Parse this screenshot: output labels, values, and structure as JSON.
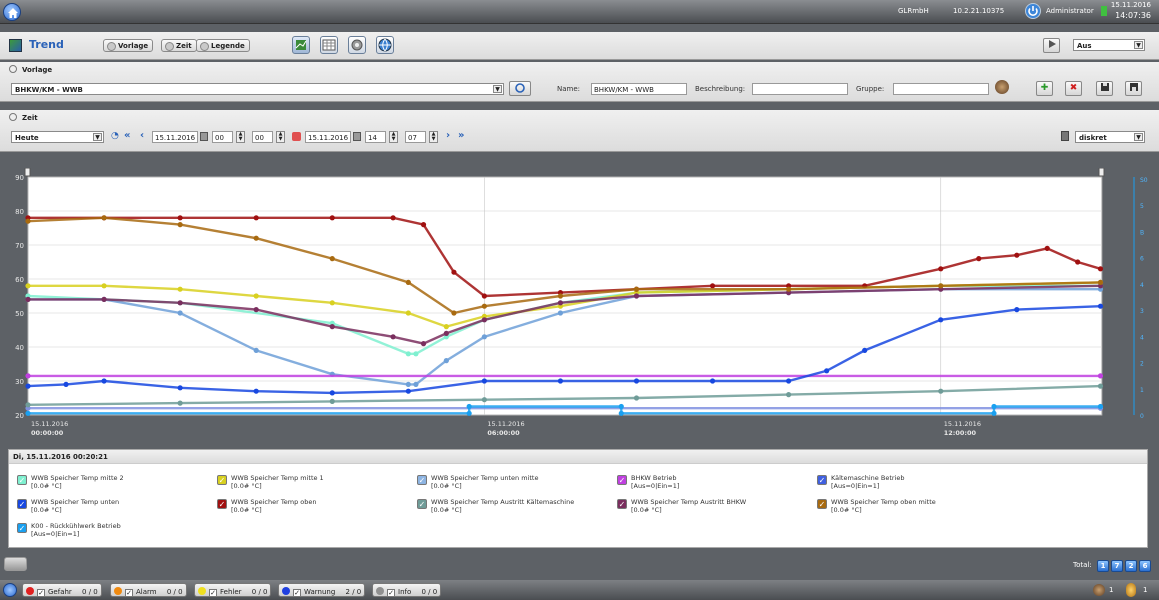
{
  "topbar": {
    "company": "GLRmbH",
    "ip": "10.2.21.10375",
    "user": "Administrator",
    "date": "15.11.2016",
    "time": "14:07:36"
  },
  "header": {
    "title": "Trend",
    "buttons": [
      "Vorlage",
      "Zeit",
      "Legende"
    ],
    "play_select": "Aus"
  },
  "vorlage": {
    "section_label": "Vorlage",
    "selected": "BHKW/KM - WWB",
    "name_label": "Name:",
    "name_value": "BHKW/KM - WWB",
    "desc_label": "Beschreibung:",
    "desc_value": "",
    "group_label": "Gruppe:",
    "group_value": ""
  },
  "zeit": {
    "section_label": "Zeit",
    "range": "Heute",
    "from_date": "15.11.2016",
    "from_h": "00",
    "from_m": "00",
    "to_date": "15.11.2016",
    "to_h": "14",
    "to_m": "07",
    "mode": "diskret"
  },
  "chart_data": {
    "type": "line",
    "ylim": [
      20,
      90
    ],
    "yticks": [
      "90",
      "80",
      "70",
      "60",
      "50",
      "40",
      "30",
      "20"
    ],
    "right_ticks": [
      "S0",
      "5",
      "B",
      "6",
      "4",
      "3",
      "4",
      "2",
      "1",
      "0"
    ],
    "x_range": [
      "00:00",
      "14:07"
    ],
    "xticks": [
      {
        "date": "15.11.2016",
        "time": "00:00:00",
        "h": 0
      },
      {
        "date": "15.11.2016",
        "time": "06:00:00",
        "h": 6
      },
      {
        "date": "15.11.2016",
        "time": "12:00:00",
        "h": 12
      }
    ],
    "series": [
      {
        "name": "WWB Speicher Temp mitte 2",
        "color": "#7ff0d0",
        "x": [
          0,
          2,
          4,
          5,
          5.1,
          5.5,
          6,
          7,
          8,
          10,
          12,
          14.1
        ],
        "values": [
          55,
          53,
          47,
          38,
          38,
          43,
          48,
          53,
          56,
          57,
          58,
          58
        ]
      },
      {
        "name": "WWB Speicher Temp mitte 1",
        "color": "#d8d020",
        "x": [
          0,
          1,
          2,
          3,
          4,
          5,
          5.5,
          6,
          7,
          8,
          10,
          12,
          14.1
        ],
        "values": [
          58,
          58,
          57,
          55,
          53,
          50,
          46,
          49,
          52,
          56,
          57,
          58,
          59
        ]
      },
      {
        "name": "WWB Speicher Temp unten mitte",
        "color": "#6ea0d8",
        "x": [
          0,
          1,
          2,
          3,
          4,
          5,
          5.1,
          5.5,
          6,
          7,
          8,
          10,
          12,
          14.1
        ],
        "values": [
          54,
          54,
          50,
          39,
          32,
          29,
          29,
          36,
          43,
          50,
          55,
          56,
          57,
          57
        ]
      },
      {
        "name": "BHKW Betrieb",
        "color": "#c040e0",
        "x": [
          0,
          14.1
        ],
        "values": [
          31.5,
          31.5
        ]
      },
      {
        "name": "Kältemaschine Betrieb",
        "color": "#8090e0",
        "x": [
          0,
          14.1
        ],
        "values": [
          22,
          22
        ]
      },
      {
        "name": "WWB Speicher Temp unten",
        "color": "#1848e0",
        "x": [
          0,
          0.5,
          1,
          2,
          3,
          4,
          5,
          6,
          7,
          8,
          9,
          10,
          10.5,
          11,
          12,
          13,
          14.1
        ],
        "values": [
          28.5,
          29,
          30,
          28,
          27,
          26.5,
          27,
          30,
          30,
          30,
          30,
          30,
          33,
          39,
          48,
          51,
          52
        ]
      },
      {
        "name": "WWB Speicher Temp oben",
        "color": "#a01010",
        "x": [
          0,
          1,
          2,
          3,
          4,
          4.8,
          5.2,
          5.6,
          6,
          7,
          8,
          9,
          10,
          11,
          12,
          12.5,
          13,
          13.4,
          13.8,
          14.1
        ],
        "values": [
          78,
          78,
          78,
          78,
          78,
          78,
          76,
          62,
          55,
          56,
          57,
          58,
          58,
          58,
          63,
          66,
          67,
          69,
          65,
          63
        ]
      },
      {
        "name": "WWB Speicher Temp Austritt Kältemaschine",
        "color": "#6f9c98",
        "x": [
          0,
          2,
          4,
          6,
          8,
          10,
          12,
          14.1
        ],
        "values": [
          23,
          23.5,
          24,
          24.5,
          25,
          26,
          27,
          28.5
        ]
      },
      {
        "name": "WWB Speicher Temp Austritt BHKW",
        "color": "#7a2e5e",
        "x": [
          0,
          1,
          2,
          3,
          4,
          4.8,
          5.2,
          5.5,
          6,
          7,
          8,
          10,
          12,
          14.1
        ],
        "values": [
          54,
          54,
          53,
          51,
          46,
          43,
          41,
          44,
          48,
          53,
          55,
          56,
          57,
          58
        ]
      },
      {
        "name": "WWB Speicher Temp oben mitte",
        "color": "#a86a10",
        "x": [
          0,
          1,
          2,
          3,
          4,
          5,
          5.6,
          6,
          7,
          8,
          10,
          12,
          14.1
        ],
        "values": [
          77,
          78,
          76,
          72,
          66,
          59,
          50,
          52,
          55,
          57,
          57,
          58,
          59
        ]
      },
      {
        "name": "K00 - Rückkühlwerk Betrieb",
        "color": "#1aa0f0",
        "x": [
          0,
          5.8,
          5.8,
          7.8,
          7.8,
          12.7,
          12.7,
          14.1
        ],
        "values": [
          20.5,
          20.5,
          22.5,
          22.5,
          20.5,
          20.5,
          22.5,
          22.5
        ]
      }
    ]
  },
  "legend": {
    "header": "Di, 15.11.2016 00:20:21",
    "items": [
      {
        "name": "WWB Speicher Temp mitte 2",
        "sub": "[0.0# °C]",
        "color": "#7ff0d0"
      },
      {
        "name": "WWB Speicher Temp mitte 1",
        "sub": "[0.0# °C]",
        "color": "#d8d020"
      },
      {
        "name": "WWB Speicher Temp unten mitte",
        "sub": "[0.0# °C]",
        "color": "#8db4e2"
      },
      {
        "name": "BHKW Betrieb",
        "sub": "[Aus=0|Ein=1]",
        "color": "#c040e0"
      },
      {
        "name": "Kältemaschine Betrieb",
        "sub": "[Aus=0|Ein=1]",
        "color": "#4060e0"
      },
      {
        "name": "WWB Speicher Temp unten",
        "sub": "[0.0# °C]",
        "color": "#1848e0"
      },
      {
        "name": "WWB Speicher Temp oben",
        "sub": "[0.0# °C]",
        "color": "#a01010"
      },
      {
        "name": "WWB Speicher Temp Austritt Kältemaschine",
        "sub": "[0.0# °C]",
        "color": "#6f9c98"
      },
      {
        "name": "WWB Speicher Temp Austritt BHKW",
        "sub": "[0.0# °C]",
        "color": "#7a2e5e"
      },
      {
        "name": "WWB Speicher Temp oben mitte",
        "sub": "[0.0# °C]",
        "color": "#a86a10"
      },
      {
        "name": "K00 - Rückkühlwerk Betrieb",
        "sub": "[Aus=0|Ein=1]",
        "color": "#1aa0f0"
      }
    ]
  },
  "total": {
    "label": "Total:",
    "pages": [
      "1",
      "7",
      "2",
      "6"
    ]
  },
  "status": [
    {
      "label": "Gefahr",
      "count": "0 / 0",
      "color": "#e02020"
    },
    {
      "label": "Alarm",
      "count": "0 / 0",
      "color": "#f08a10"
    },
    {
      "label": "Fehler",
      "count": "0 / 0",
      "color": "#f0e020"
    },
    {
      "label": "Warnung",
      "count": "2 / 0",
      "color": "#2040e0"
    },
    {
      "label": "Info",
      "count": "0 / 0",
      "color": "#909090"
    }
  ],
  "status_right": {
    "users": "1",
    "persons": "1"
  }
}
